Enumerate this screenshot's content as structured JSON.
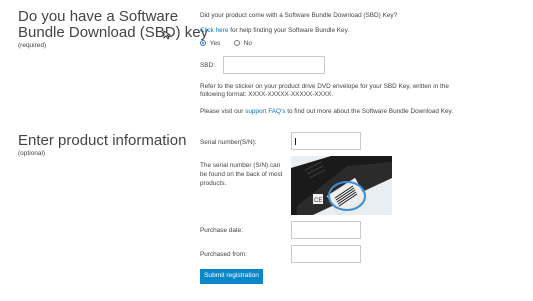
{
  "sbd_section": {
    "heading_line1": "Do you have a Software",
    "heading_line2": "Bundle Download (SBD) key",
    "required": "(required)",
    "question": "Did your product come with a Software Bundle Download (SBD) Key?",
    "help_link": "Click here",
    "help_suffix": "for help finding your Software Bundle Key.",
    "yes_label": "Yes",
    "no_label": "No",
    "selected": "Yes",
    "sbd_label": "SBD:",
    "sbd_value": "",
    "instructions_line1": "Refer to the sticker on your product drive DVD envelope for your SBD Key, written in the",
    "instructions_line2": "following format: XXXX-XXXXX-XXXXX-XXXX.",
    "faq_prefix": "Please visit our",
    "faq_link": "support FAQ's",
    "faq_suffix": "to find out more about the Software Bundle Download Key."
  },
  "product_section": {
    "heading": "Enter product information",
    "optional": "(optional)",
    "serial_label": "Serial number(S/N):",
    "serial_value": "",
    "serial_hint_line1": "The serial number (S/N) can",
    "serial_hint_line2": "be found on the back of most",
    "serial_hint_line3": "products.",
    "purchase_date_label": "Purchase date:",
    "purchase_date_value": "",
    "purchased_from_label": "Purchased from:",
    "purchased_from_value": "",
    "submit_label": "Submit registration"
  }
}
